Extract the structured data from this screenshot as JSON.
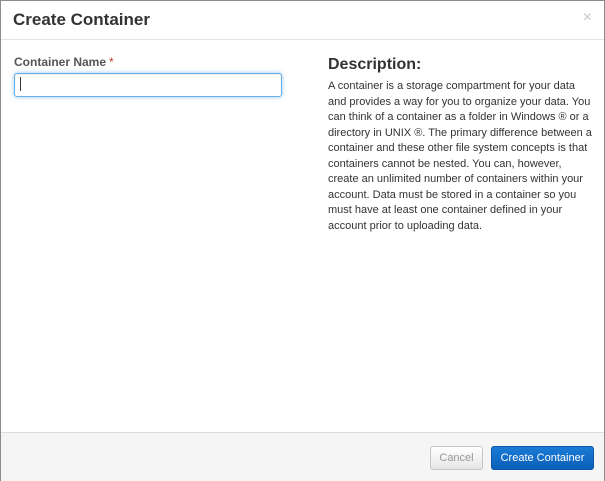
{
  "modal": {
    "title": "Create Container",
    "close_icon": "×"
  },
  "form": {
    "container_name_label": "Container Name",
    "required_marker": "*",
    "container_name_value": "",
    "container_name_placeholder": ""
  },
  "description": {
    "title": "Description:",
    "text": "A container is a storage compartment for your data and provides a way for you to organize your data. You can think of a container as a folder in Windows ® or a directory in UNIX ®. The primary difference between a container and these other file system concepts is that containers cannot be nested. You can, however, create an unlimited number of containers within your account. Data must be stored in a container so you must have at least one container defined in your account prior to uploading data."
  },
  "footer": {
    "cancel_label": "Cancel",
    "create_label": "Create Container"
  },
  "colors": {
    "primary_button": "#0b5fb8",
    "focus_border": "#66afe9",
    "footer_background": "#f5f5f5"
  }
}
